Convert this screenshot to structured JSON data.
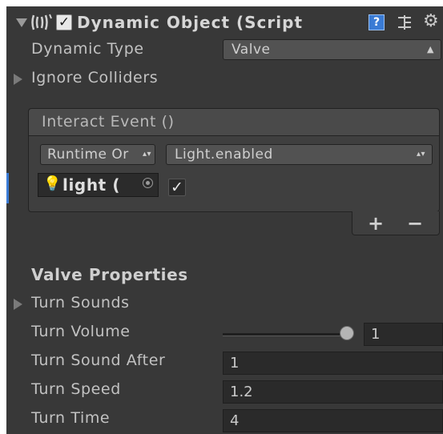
{
  "component": {
    "title": "Dynamic Object (Script",
    "enabled_check": "✓",
    "dynamic_type_label": "Dynamic Type",
    "dynamic_type_value": "Valve",
    "ignore_colliders_label": "Ignore Colliders"
  },
  "event": {
    "header": "Interact Event ()",
    "runtime_value": "Runtime Or",
    "function_value": "Light.enabled",
    "object_value": "light (",
    "bool_check": "✓",
    "add_symbol": "+",
    "remove_symbol": "−"
  },
  "valve": {
    "section_title": "Valve Properties",
    "turn_sounds_label": "Turn Sounds",
    "turn_volume_label": "Turn Volume",
    "turn_volume_value": "1",
    "turn_volume_fraction": 1.0,
    "turn_sound_after_label": "Turn Sound After",
    "turn_sound_after_value": "1",
    "turn_speed_label": "Turn Speed",
    "turn_speed_value": "1.2",
    "turn_time_label": "Turn Time",
    "turn_time_value": "4"
  },
  "icons": {
    "script": "script-icon",
    "help": "help-icon",
    "preset": "preset-icon",
    "gear": "gear-icon",
    "light": "light-bulb-icon",
    "target": "object-picker-icon"
  },
  "colors": {
    "panel_bg": "#383838",
    "field_bg": "#2a2a2a",
    "accent_blue": "#3a7bd5"
  }
}
